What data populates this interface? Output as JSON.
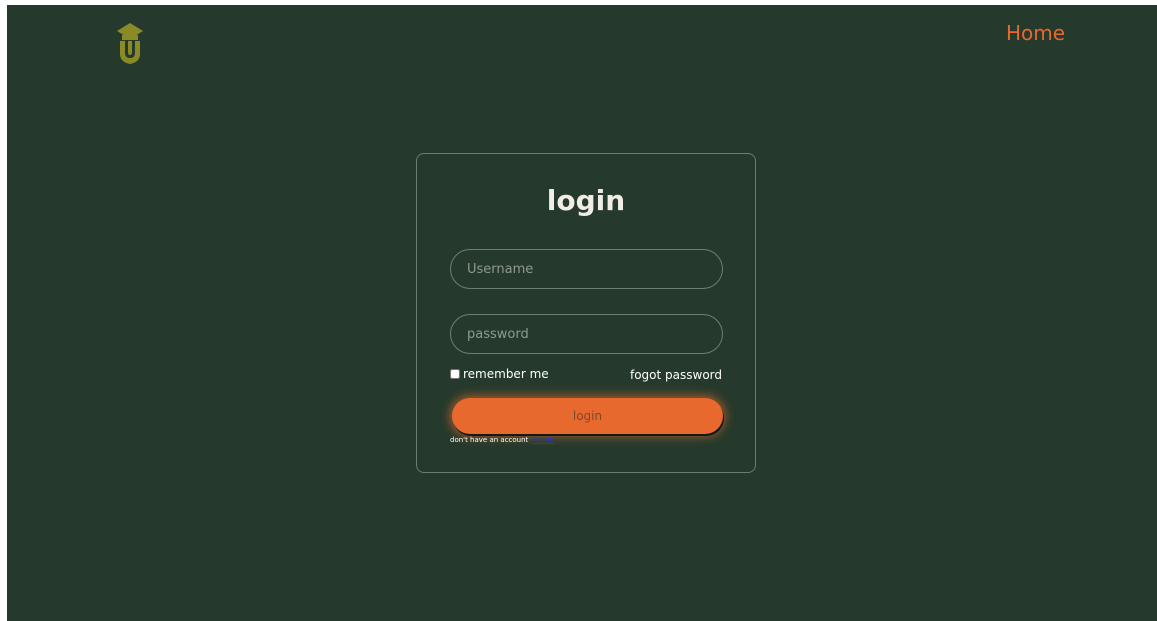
{
  "nav": {
    "home_label": "Home"
  },
  "logo": {
    "icon": "graduation-shield-logo",
    "color": "#8a8b27"
  },
  "login_form": {
    "title": "login",
    "username_placeholder": "Username",
    "password_placeholder": "password",
    "remember_label": "remember me",
    "forgot_label": "fogot password",
    "submit_label": "login",
    "signup_prompt": "don't have an account",
    "signup_link_label": "signup"
  },
  "colors": {
    "background": "#253a2c",
    "accent": "#e8692e",
    "text": "#f1ece4"
  }
}
